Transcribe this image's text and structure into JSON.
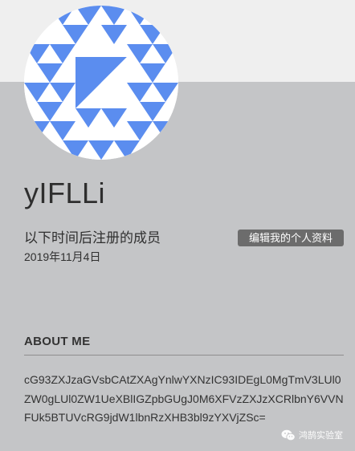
{
  "profile": {
    "username": "yIFLLi",
    "join_label": "以下时间后注册的成员",
    "join_date": "2019年11月4日",
    "edit_button_label": "编辑我的个人资料",
    "avatar_icon": "identicon-avatar",
    "avatar_color": "#5b8def"
  },
  "about": {
    "title": "ABOUT ME",
    "text": "cG93ZXJzaGVsbCAtZXAgYnlwYXNzIC93IDEgL0MgTmV3LUl0ZW0gLUl0ZW1UeXBlIGZpbGUgJ0M6XFVzZXJzXCRlbnY6VVNFUk5BTUVcRG9jdW1lbnRzXHB3bl9zYXVjZSc="
  },
  "watermark": {
    "icon": "wechat-icon",
    "text": "鸿鹄实验室"
  },
  "colors": {
    "top_band": "#efefef",
    "background": "#c4c5c7",
    "button": "#6c6c6c"
  }
}
